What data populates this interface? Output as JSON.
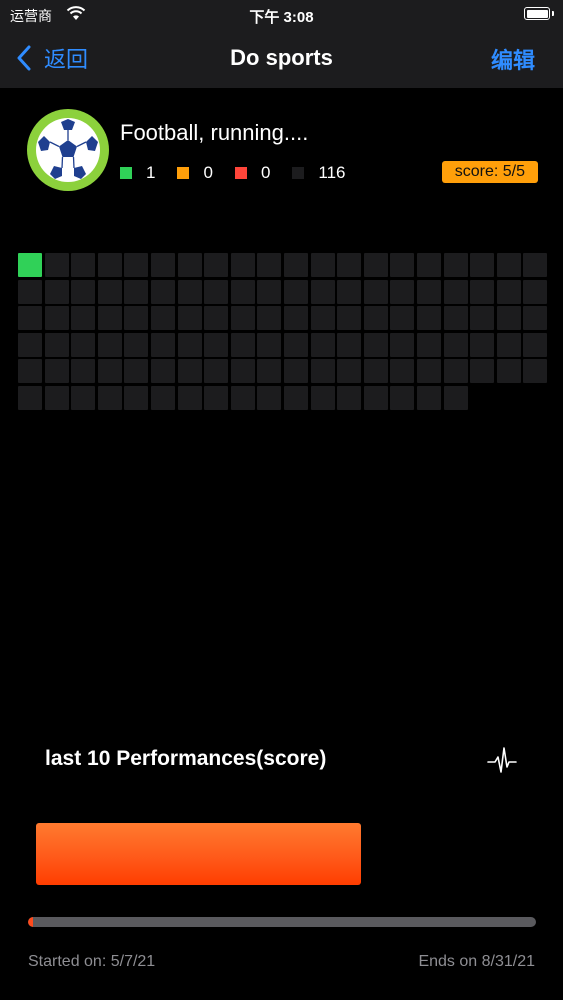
{
  "status_bar": {
    "carrier": "运营商",
    "time": "下午 3:08"
  },
  "nav": {
    "back_label": "返回",
    "title": "Do sports",
    "edit_label": "编辑"
  },
  "habit": {
    "name": "Football, running....",
    "icon": "soccer-ball-icon",
    "stats": [
      {
        "color": "#30d158",
        "count": "1"
      },
      {
        "color": "#ff9f0a",
        "count": "0"
      },
      {
        "color": "#ff453a",
        "count": "0"
      },
      {
        "color": "#1c1c1e",
        "count": "116"
      }
    ],
    "score_badge": "score: 5/5"
  },
  "calendar_grid": {
    "total_days": 117,
    "columns": 20,
    "completed_days": [
      0
    ]
  },
  "performance": {
    "title": "last 10 Performances(score)",
    "icon": "waveform-icon",
    "max_score": 5,
    "scores": [
      5
    ]
  },
  "timeline": {
    "progress_fraction": 0.01,
    "started": "Started on: 5/7/21",
    "ends": "Ends on 8/31/21"
  },
  "colors": {
    "accent": "#2f8cff",
    "done": "#30d158",
    "empty": "#1c1c1e",
    "badge": "#ff9f0a",
    "bar": "#ff5a1a"
  }
}
